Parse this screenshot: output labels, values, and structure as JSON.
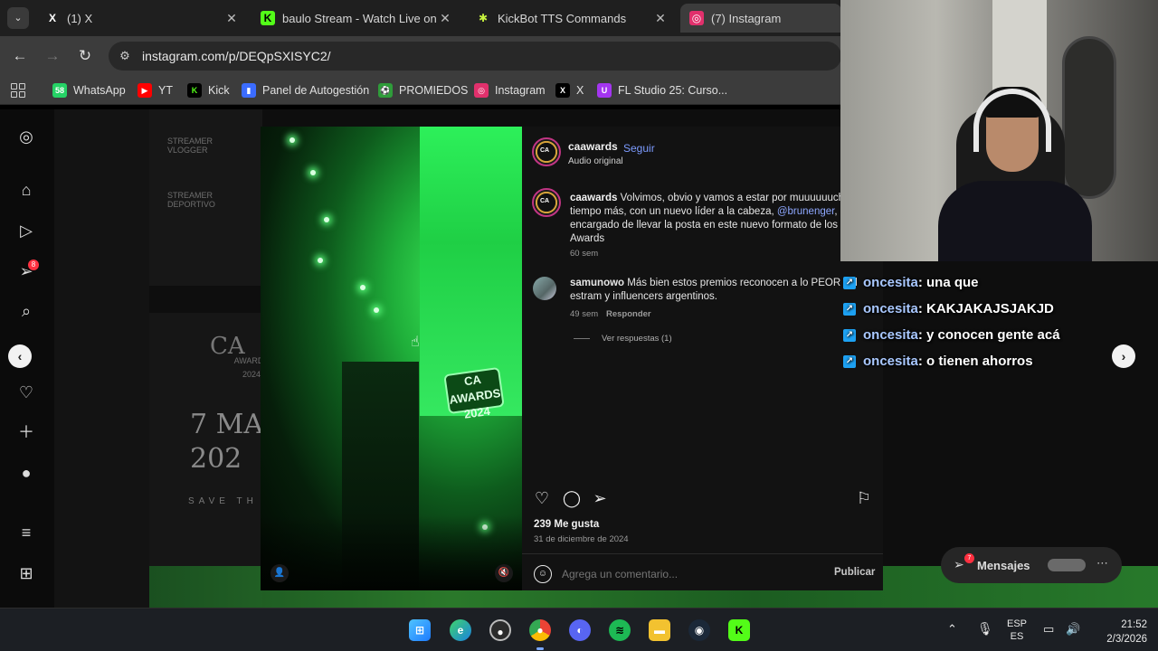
{
  "browser": {
    "tabs": [
      {
        "title": "(1) X",
        "favicon": "X",
        "color": "#000000"
      },
      {
        "title": "baulo Stream - Watch Live on K",
        "favicon": "K",
        "color": "#53fc18"
      },
      {
        "title": "KickBot TTS Commands",
        "favicon": "✱",
        "color": "#c7f23e"
      },
      {
        "title": "(7) Instagram",
        "favicon": "◎",
        "color": "#e1306c"
      }
    ],
    "url": "instagram.com/p/DEQpSXISYC2/",
    "bookmarks": [
      {
        "label": "WhatsApp",
        "icon": "58",
        "color": "#25d366"
      },
      {
        "label": "YT",
        "icon": "▶",
        "color": "#ff0000"
      },
      {
        "label": "Kick",
        "icon": "K",
        "color": "#53fc18"
      },
      {
        "label": "Panel de Autogestión",
        "icon": "▮",
        "color": "#3b6cff"
      },
      {
        "label": "PROMIEDOS",
        "icon": "⚽",
        "color": "#2f9c3a"
      },
      {
        "label": "Instagram",
        "icon": "◎",
        "color": "#e1306c"
      },
      {
        "label": "X",
        "icon": "X",
        "color": "#000000"
      },
      {
        "label": "FL Studio 25: Curso...",
        "icon": "U",
        "color": "#a435f0"
      }
    ]
  },
  "ig": {
    "sidebar_badge": "8",
    "backdrop": {
      "laurels": [
        "STREAMER VLOGGER",
        "STREAMER DEPORTIVO"
      ],
      "ca_text": "CA",
      "awards_small": "AWARDS",
      "year_small": "2024",
      "date_big_1": "7 MA",
      "date_big_2": "202",
      "save_the": "SAVE TH"
    },
    "media_logo": "CA AWARDS 2024",
    "post": {
      "username": "caawards",
      "follow": "Seguir",
      "audio": "Audio original",
      "caption_user": "caawards",
      "caption_text_1": " Volvimos, obvio y vamos a estar por muuuuuucho tiempo más, con un nuevo líder a la cabeza, ",
      "caption_mention": "@brunenger",
      "caption_text_2": ", encargado de llevar la posta en este nuevo formato de los CA Awards",
      "caption_time": "60 sem",
      "comment_user": "samunowo",
      "comment_text": " Más bien estos premios reconocen a lo PEOR del estram y influencers argentinos.",
      "comment_time": "49 sem",
      "comment_reply": "Responder",
      "view_replies": "Ver respuestas (1)",
      "likes": "239 Me gusta",
      "date": "31 de diciembre de 2024",
      "comment_placeholder": "Agrega un comentario...",
      "publish": "Publicar"
    },
    "messages": {
      "label": "Mensajes",
      "badge": "7"
    }
  },
  "chat": [
    {
      "nick": "oncesita",
      "msg": " : una que"
    },
    {
      "nick": "oncesita",
      "msg": " : KAKJAKAJSJAKJD"
    },
    {
      "nick": "oncesita",
      "msg": " : y conocen gente acá"
    },
    {
      "nick": "oncesita",
      "msg": " : o tienen ahorros"
    }
  ],
  "taskbar": {
    "lang_1": "ESP",
    "lang_2": "ES",
    "time": "21:52",
    "date": "2/3/2026"
  }
}
